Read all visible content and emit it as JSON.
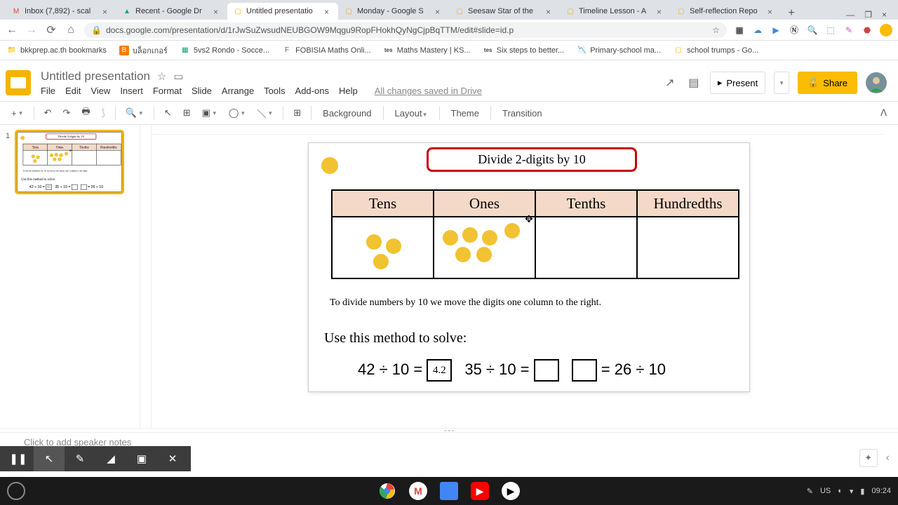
{
  "tabs": [
    {
      "title": "Inbox (7,892) - scal",
      "fav": "M"
    },
    {
      "title": "Recent - Google Dr",
      "fav": "▲"
    },
    {
      "title": "Untitled presentatio",
      "fav": "▢",
      "active": true
    },
    {
      "title": "Monday - Google S",
      "fav": "▢"
    },
    {
      "title": "Seesaw Star of the",
      "fav": "▢"
    },
    {
      "title": "Timeline Lesson - A",
      "fav": "▢"
    },
    {
      "title": "Self-reflection Repo",
      "fav": "▢"
    }
  ],
  "url": "docs.google.com/presentation/d/1rJwSuZwsudNEUBGOW9Mqgu9RopFHokhQyNgCjpBqTTM/edit#slide=id.p",
  "bookmarks": [
    {
      "label": "bkkprep.ac.th bookmarks",
      "icon": "📁"
    },
    {
      "label": "บล็อกเกอร์",
      "icon": "B"
    },
    {
      "label": "5vs2 Rondo - Socce...",
      "icon": "▦"
    },
    {
      "label": "FOBISIA Maths Onli...",
      "icon": "F"
    },
    {
      "label": "Maths Mastery | KS...",
      "icon": "tes"
    },
    {
      "label": "Six steps to better...",
      "icon": "tes"
    },
    {
      "label": "Primary-school ma...",
      "icon": "📉"
    },
    {
      "label": "school trumps - Go...",
      "icon": "▢"
    }
  ],
  "doc": {
    "title": "Untitled presentation",
    "menus": [
      "File",
      "Edit",
      "View",
      "Insert",
      "Format",
      "Slide",
      "Arrange",
      "Tools",
      "Add-ons",
      "Help"
    ],
    "saved": "All changes saved in Drive",
    "present": "Present",
    "share": "Share"
  },
  "toolbar": {
    "background": "Background",
    "layout": "Layout",
    "theme": "Theme",
    "transition": "Transition"
  },
  "slide": {
    "title": "Divide 2-digits by 10",
    "cols": [
      "Tens",
      "Ones",
      "Tenths",
      "Hundredths"
    ],
    "text1": "To divide numbers by 10 we move the digits one column to the right.",
    "text2": "Use this method to solve:",
    "eq1": "42 ÷ 10 =",
    "ans1": "4.2",
    "eq2": "35 ÷ 10 =",
    "eq3": "= 26 ÷ 10"
  },
  "notes": {
    "placeholder": "Click to add speaker notes"
  },
  "filmstrip": {
    "num": "1"
  },
  "shelf": {
    "lang": "US",
    "time": "09:24"
  }
}
